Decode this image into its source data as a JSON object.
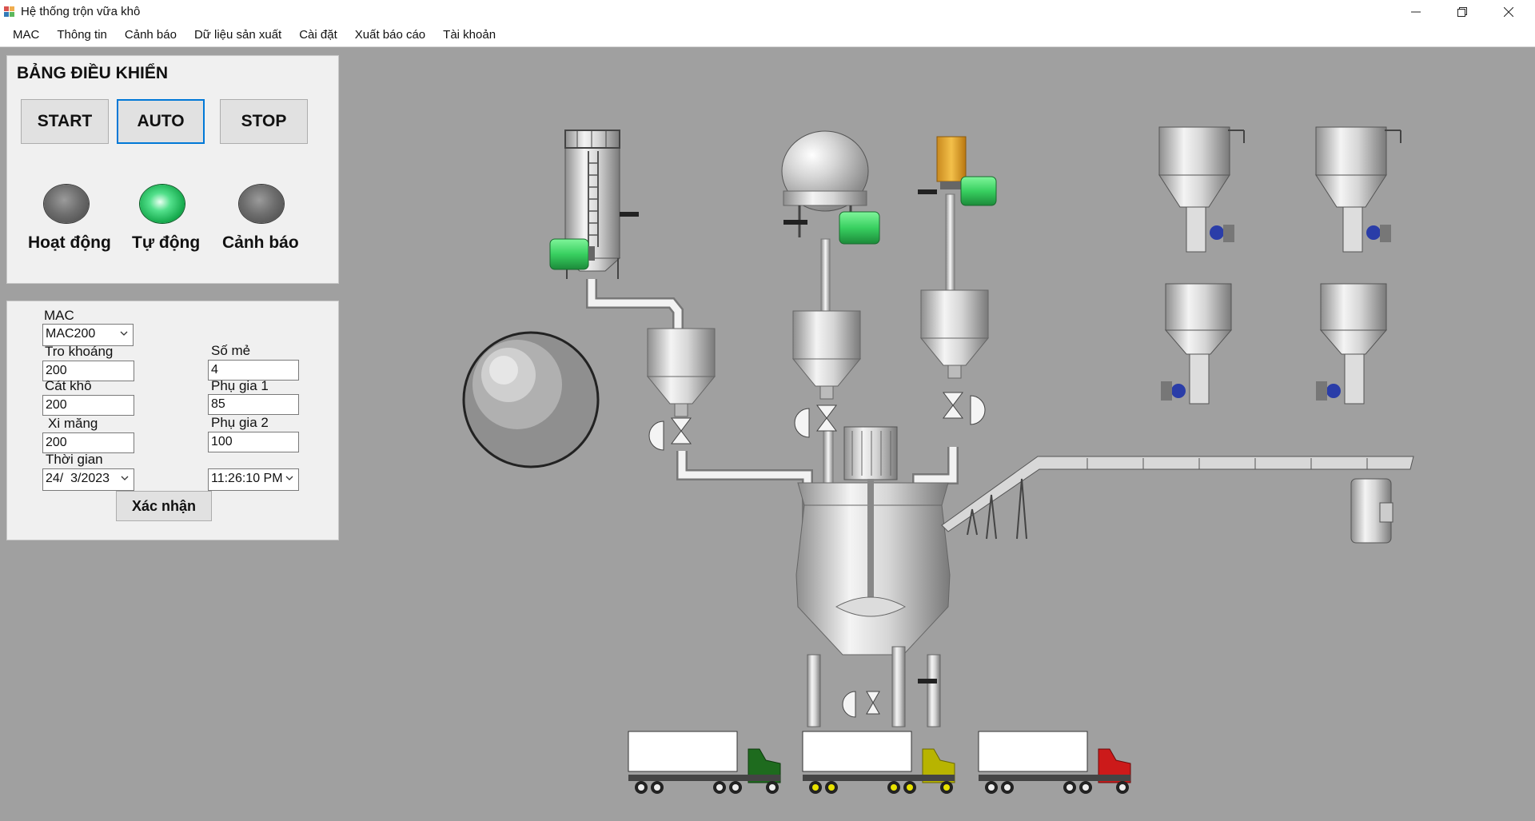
{
  "window": {
    "title": "Hệ thống trộn vữa khô",
    "minimize_label": "—",
    "restore_label": "❐",
    "close_label": "✕"
  },
  "menu": [
    "MAC",
    "Thông tin",
    "Cảnh báo",
    "Dữ liệu sản xuất",
    "Cài đặt",
    "Xuất báo cáo",
    "Tài khoản"
  ],
  "control_panel": {
    "title": "BẢNG ĐIỀU KHIỂN",
    "start_label": "START",
    "auto_label": "AUTO",
    "stop_label": "STOP",
    "lamps": [
      {
        "label": "Hoạt động",
        "state": "off"
      },
      {
        "label": "Tự động",
        "state": "on"
      },
      {
        "label": "Cảnh báo",
        "state": "off"
      }
    ]
  },
  "form": {
    "mac_label": "MAC",
    "mac_value": "MAC200",
    "tro_khoang_label": "Tro khoáng",
    "tro_khoang_value": "200",
    "so_me_label": "Số mẻ",
    "so_me_value": "4",
    "cat_kho_label": "Cát khô",
    "cat_kho_value": "200",
    "phu_gia_1_label": "Phụ gia 1",
    "phu_gia_1_value": "85",
    "xi_mang_label": "Xi măng",
    "xi_mang_value": "200",
    "phu_gia_2_label": "Phụ gia 2",
    "phu_gia_2_value": "100",
    "thoi_gian_label": "Thời gian",
    "date_value": "24/  3/2023",
    "time_value": "11:26:10 PM",
    "confirm_label": "Xác nhận"
  },
  "colors": {
    "background": "#a0a0a0",
    "panel": "#f0f0f0",
    "motor_green": "#38d060",
    "accent_blue": "#0078d7",
    "truck_cab_colors": [
      "#1e6b1e",
      "#b8b400",
      "#cc1a1a"
    ]
  }
}
